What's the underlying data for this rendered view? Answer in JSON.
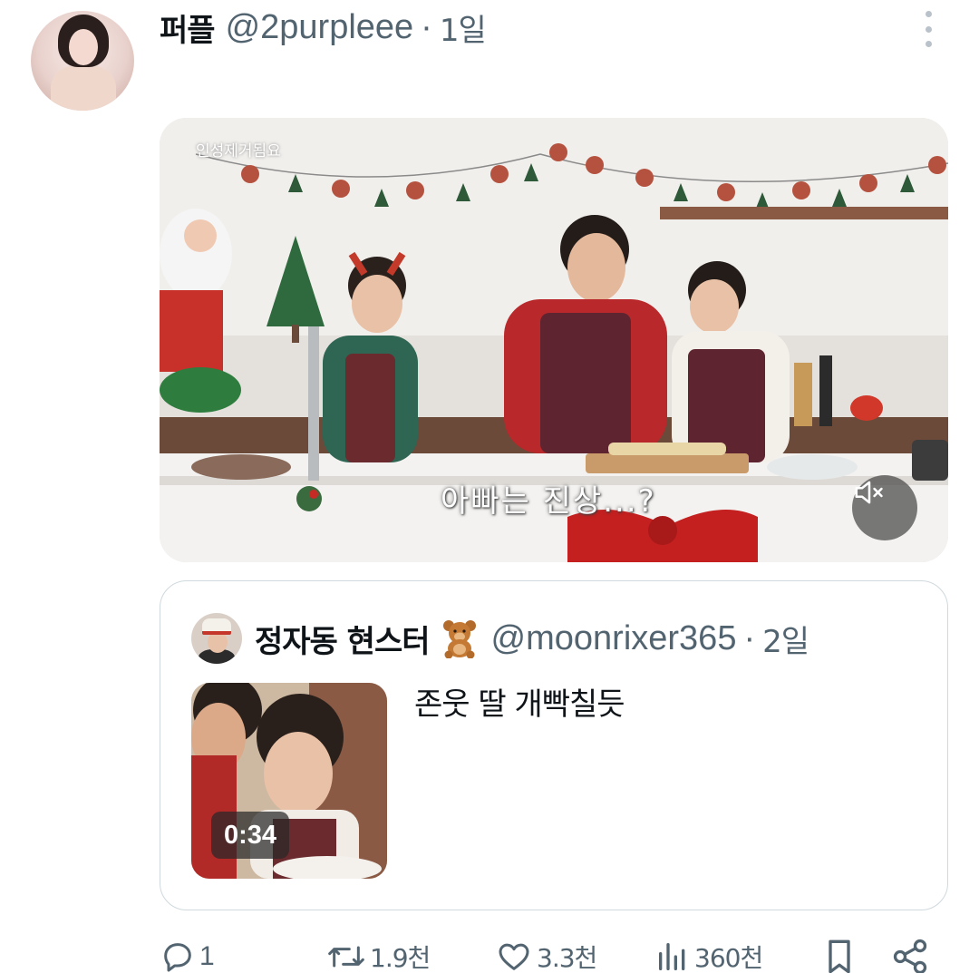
{
  "tweet": {
    "display_name": "퍼플",
    "handle": "@2purpleee",
    "separator": "·",
    "time": "1일",
    "more_icon": "more-vertical-icon"
  },
  "media": {
    "watermark": "인성제거됨요",
    "caption": "아빠는 진상...?",
    "mute_icon": "volume-muted-icon"
  },
  "quoted": {
    "display_name": "정자동 현스터",
    "emoji": "teddy-bear-emoji",
    "handle": "@moonrixer365",
    "separator": "·",
    "time": "2일",
    "text": "존웃 딸 개빡칠듯",
    "video_duration": "0:34"
  },
  "actions": {
    "reply": {
      "icon": "reply-icon",
      "count": "1"
    },
    "retweet": {
      "icon": "retweet-icon",
      "count": "1.9천"
    },
    "like": {
      "icon": "heart-icon",
      "count": "3.3천"
    },
    "views": {
      "icon": "views-icon",
      "count": "360천"
    },
    "bookmark": {
      "icon": "bookmark-icon"
    },
    "share": {
      "icon": "share-icon"
    }
  },
  "colors": {
    "text_primary": "#0f1419",
    "text_secondary": "#536471",
    "border": "#cfd9de"
  }
}
